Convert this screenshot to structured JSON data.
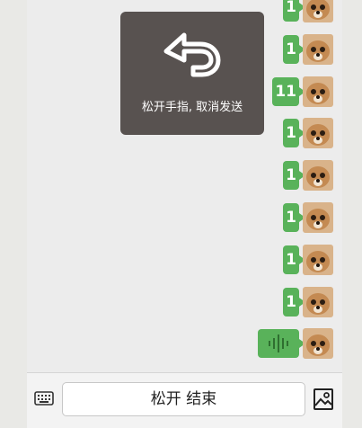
{
  "messages": [
    {
      "type": "text",
      "text": "1"
    },
    {
      "type": "text",
      "text": "1"
    },
    {
      "type": "text",
      "text": "11"
    },
    {
      "type": "text",
      "text": "1"
    },
    {
      "type": "text",
      "text": "1"
    },
    {
      "type": "text",
      "text": "1"
    },
    {
      "type": "text",
      "text": "1"
    },
    {
      "type": "text",
      "text": "1"
    },
    {
      "type": "voice",
      "icon": "voice-wave-icon"
    }
  ],
  "toast": {
    "icon": "undo-arrow-icon",
    "text": "松开手指, 取消发送"
  },
  "bottom_bar": {
    "keyboard_icon": "keyboard-icon",
    "hold_button_label": "松开 结束",
    "image_icon": "image-icon"
  },
  "colors": {
    "bubble": "#59b25a",
    "toast_bg": "#585250",
    "chat_bg": "#ececec"
  }
}
